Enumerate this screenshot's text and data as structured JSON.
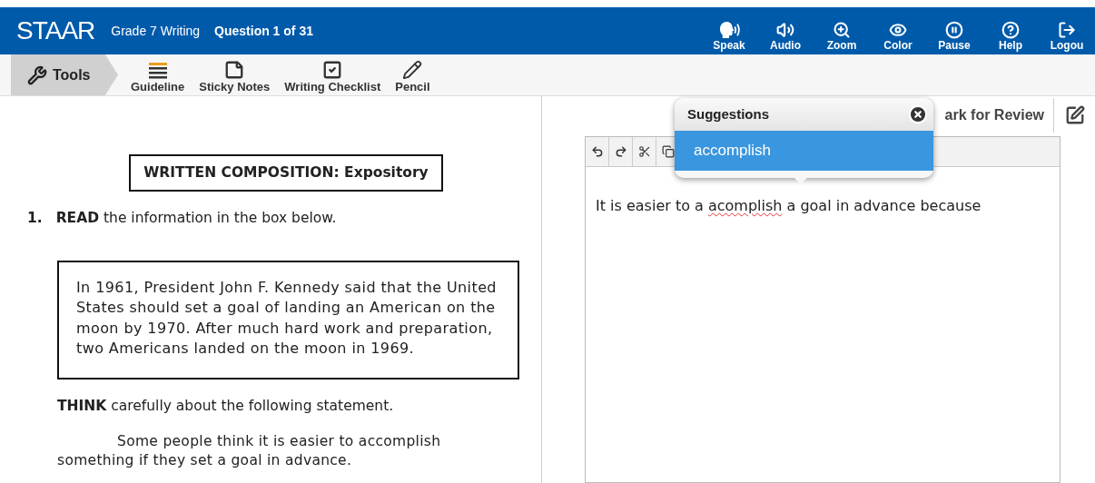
{
  "header": {
    "logo": "STAAR",
    "test": "Grade 7 Writing",
    "question": "Question 1 of 31",
    "actions": [
      {
        "kind": "speak",
        "label": "Speak"
      },
      {
        "kind": "audio",
        "label": "Audio"
      },
      {
        "kind": "zoom",
        "label": "Zoom"
      },
      {
        "kind": "color",
        "label": "Color"
      },
      {
        "kind": "pause",
        "label": "Pause"
      },
      {
        "kind": "help",
        "label": "Help"
      },
      {
        "kind": "logout",
        "label": "Logou"
      }
    ]
  },
  "toolbar": {
    "tools_label": "Tools",
    "tools": [
      {
        "kind": "guideline",
        "label": "Guideline"
      },
      {
        "kind": "sticky",
        "label": "Sticky Notes"
      },
      {
        "kind": "checklist",
        "label": "Writing Checklist"
      },
      {
        "kind": "pencil",
        "label": "Pencil"
      }
    ]
  },
  "passage": {
    "title": "WRITTEN COMPOSITION: Expository",
    "number": "1.",
    "read": "**READ** the information in the box below.",
    "box": "In 1961, President John F. Kennedy said that the United States should set a goal of landing an American on the moon by 1970. After much hard work and preparation, two Americans landed on the moon in 1969.",
    "think": "**THINK** carefully about the following statement.",
    "statement": "Some people think it is easier to accomplish something if they set a goal in advance."
  },
  "review": {
    "label": "ark for Review"
  },
  "editor": {
    "tools": [
      {
        "kind": "undo"
      },
      {
        "kind": "redo"
      },
      {
        "kind": "cut"
      },
      {
        "kind": "copy"
      }
    ],
    "segments": [
      {
        "text": "It is easier to a ",
        "misspelled": false
      },
      {
        "text": "acomplish",
        "misspelled": true
      },
      {
        "text": " a goal in advance because",
        "misspelled": false
      }
    ]
  },
  "suggestions": {
    "title": "Suggestions",
    "items": [
      {
        "label": "accomplish",
        "selected": true
      }
    ]
  }
}
